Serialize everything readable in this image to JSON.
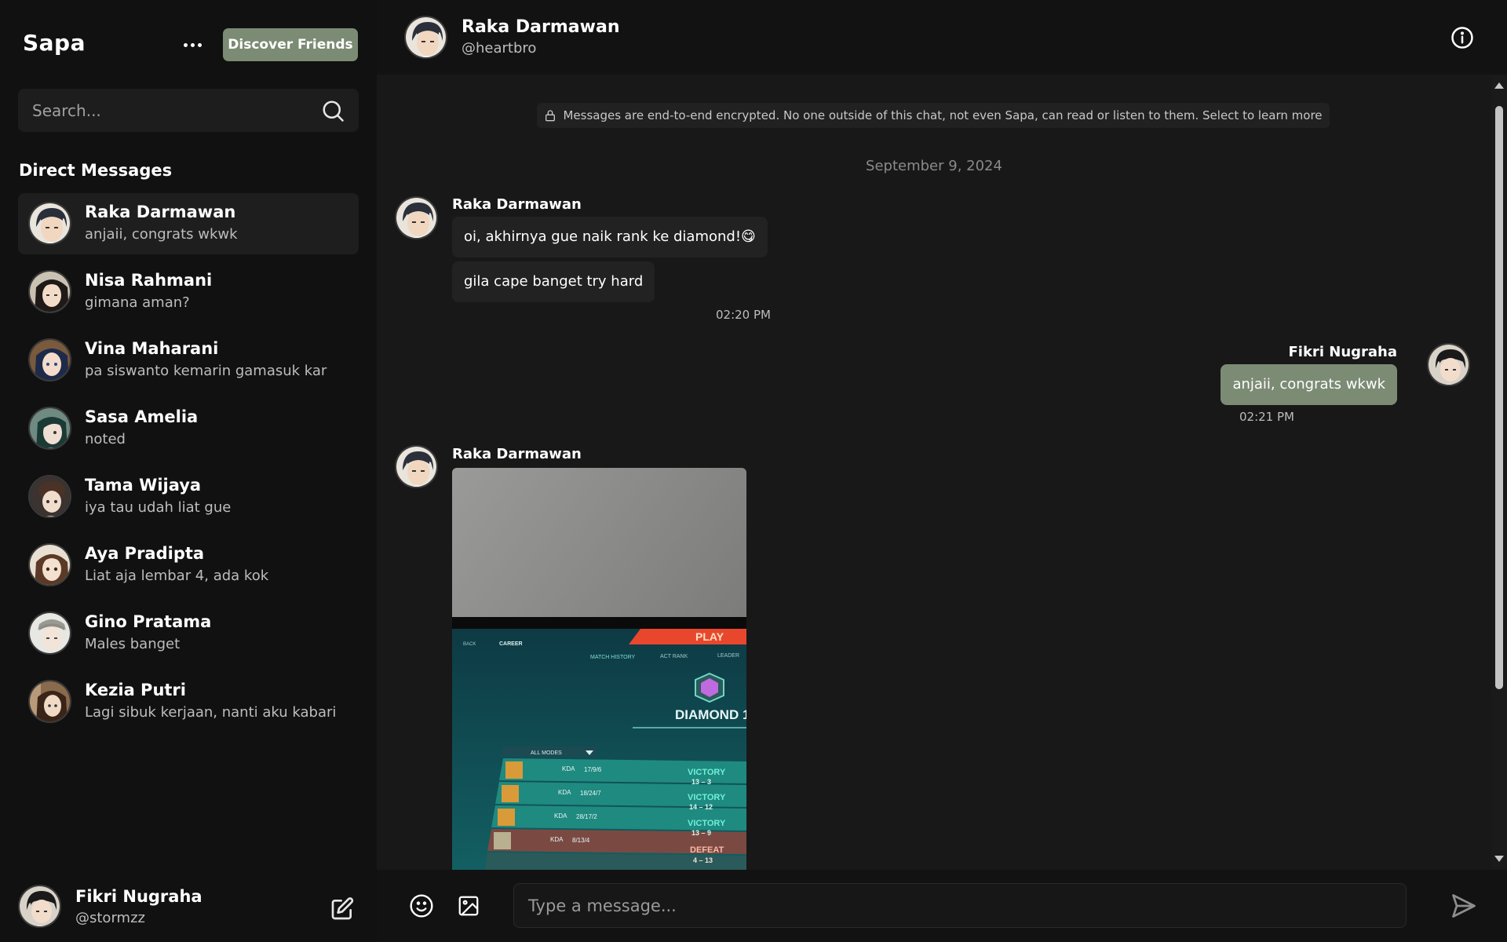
{
  "app": {
    "brand": "Sapa",
    "discover_label": "Discover Friends",
    "more_icon": "more-icon"
  },
  "search": {
    "placeholder": "Search..."
  },
  "sidebar": {
    "section_title": "Direct Messages",
    "conversations": [
      {
        "name": "Raka Darmawan",
        "preview": "anjaii, congrats wkwk",
        "active": true
      },
      {
        "name": "Nisa Rahmani",
        "preview": "gimana aman?"
      },
      {
        "name": "Vina Maharani",
        "preview": "pa siswanto kemarin gamasuk kar"
      },
      {
        "name": "Sasa Amelia",
        "preview": "noted"
      },
      {
        "name": "Tama Wijaya",
        "preview": "iya tau udah liat gue"
      },
      {
        "name": "Aya Pradipta",
        "preview": "Liat aja lembar 4, ada kok"
      },
      {
        "name": "Gino Pratama",
        "preview": "Males banget"
      },
      {
        "name": "Kezia Putri",
        "preview": "Lagi sibuk kerjaan, nanti aku kabari"
      }
    ],
    "current_user": {
      "name": "Fikri Nugraha",
      "handle": "@stormzz"
    }
  },
  "chat": {
    "header": {
      "name": "Raka Darmawan",
      "handle": "@heartbro"
    },
    "encryption_notice": "Messages are end-to-end encrypted. No one outside of this chat, not even Sapa, can read or listen to them. Select to learn more",
    "date_separator": "September 9, 2024",
    "groups": [
      {
        "sender": "Raka Darmawan",
        "messages": [
          "oi, akhirnya gue naik rank ke diamond!😋",
          "gila cape banget try hard"
        ],
        "time": "02:20 PM"
      },
      {
        "sender": "Fikri Nugraha",
        "messages": [
          "anjaii, congrats wkwk"
        ],
        "time": "02:21 PM",
        "mine": true
      },
      {
        "sender": "Raka Darmawan",
        "image": {
          "tabs": [
            "BACK",
            "CAREER",
            "MATCH HISTORY",
            "ACT RANK",
            "LEADER"
          ],
          "play": "PLAY",
          "rank": "DIAMOND 1",
          "filter": "ALL MODES",
          "rows": [
            {
              "kda": "17/9/6",
              "result": "VICTORY",
              "score": "13 – 3"
            },
            {
              "kda": "18/24/7",
              "result": "VICTORY",
              "score": "14 – 12"
            },
            {
              "kda": "28/17/2",
              "result": "VICTORY",
              "score": "13 – 9"
            },
            {
              "kda": "8/13/4",
              "result": "DEFEAT",
              "score": "4 – 13"
            }
          ]
        }
      }
    ]
  },
  "composer": {
    "placeholder": "Type a message..."
  },
  "colors": {
    "accent": "#7c8b74",
    "background": "#141414",
    "bubble": "#222222"
  }
}
